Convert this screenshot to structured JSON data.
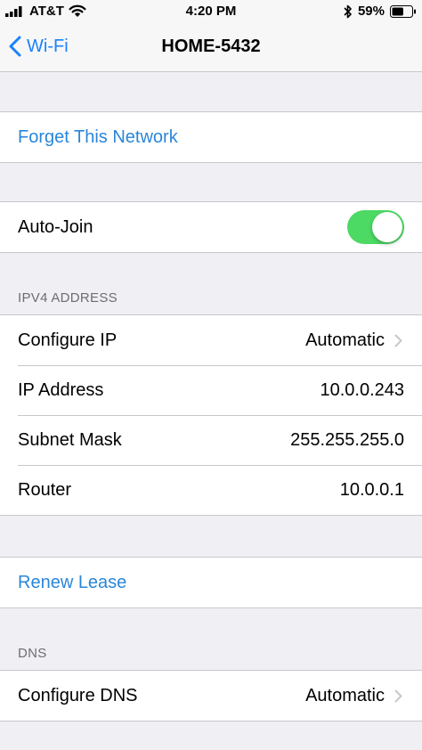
{
  "status_bar": {
    "carrier": "AT&T",
    "time": "4:20 PM",
    "battery_percent": "59%",
    "battery_level": 0.59,
    "icons": [
      "signal-icon",
      "wifi-icon",
      "bluetooth-icon",
      "battery-icon"
    ]
  },
  "nav": {
    "back_label": "Wi-Fi",
    "title": "HOME-5432"
  },
  "forget": {
    "label": "Forget This Network"
  },
  "auto_join": {
    "label": "Auto-Join",
    "enabled": true,
    "toggle_color": "#4cd964"
  },
  "ipv4": {
    "header": "IPV4 ADDRESS",
    "rows": [
      {
        "label": "Configure IP",
        "value": "Automatic"
      },
      {
        "label": "IP Address",
        "value": "10.0.0.243"
      },
      {
        "label": "Subnet Mask",
        "value": "255.255.255.0"
      },
      {
        "label": "Router",
        "value": "10.0.0.1"
      }
    ]
  },
  "renew": {
    "label": "Renew Lease"
  },
  "dns": {
    "header": "DNS",
    "rows": [
      {
        "label": "Configure DNS",
        "value": "Automatic"
      }
    ]
  },
  "colors": {
    "accent": "#1a82fb",
    "action_text": "#2a86d8",
    "background": "#efeff4",
    "separator": "#c8c7cc"
  }
}
